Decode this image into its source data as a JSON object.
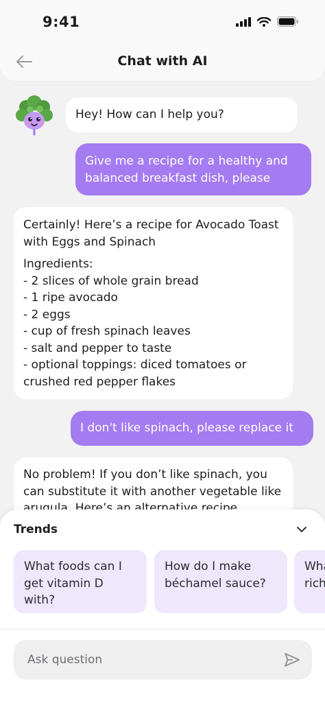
{
  "status": {
    "time": "9:41"
  },
  "header": {
    "title": "Chat with AI"
  },
  "messages": [
    {
      "role": "ai",
      "text": "Hey! How can I help you?"
    },
    {
      "role": "user",
      "text": "Give me a recipe for a healthy and balanced breakfast dish, please"
    },
    {
      "role": "ai",
      "intro": "Certainly! Here’s a recipe for Avocado Toast with Eggs and Spinach",
      "lines": [
        "Ingredients:",
        "- 2 slices of whole grain bread",
        "- 1 ripe avocado",
        "- 2 eggs",
        "- cup of fresh spinach leaves",
        "- salt and pepper to taste",
        "- optional toppings: diced tomatoes or crushed red pepper flakes"
      ]
    },
    {
      "role": "user",
      "text": "I don't like spinach, please replace it"
    },
    {
      "role": "ai",
      "text": "No problem! If you don’t like spinach, you can substitute it with another vegetable like arugula. Here’s an alternative  recipe"
    }
  ],
  "trends": {
    "title": "Trends",
    "items": [
      "What foods can I get vitamin D with?",
      "How do I make béchamel sauce?",
      "What foods are rich in fiber?"
    ]
  },
  "composer": {
    "placeholder": "Ask question"
  },
  "colors": {
    "user_bubble": "#a57bf1",
    "trend_card": "#efe8fd",
    "background": "#f2f2f2"
  },
  "icons": [
    "back-arrow-icon",
    "chevron-down-icon",
    "send-icon",
    "broccoli-avatar"
  ]
}
